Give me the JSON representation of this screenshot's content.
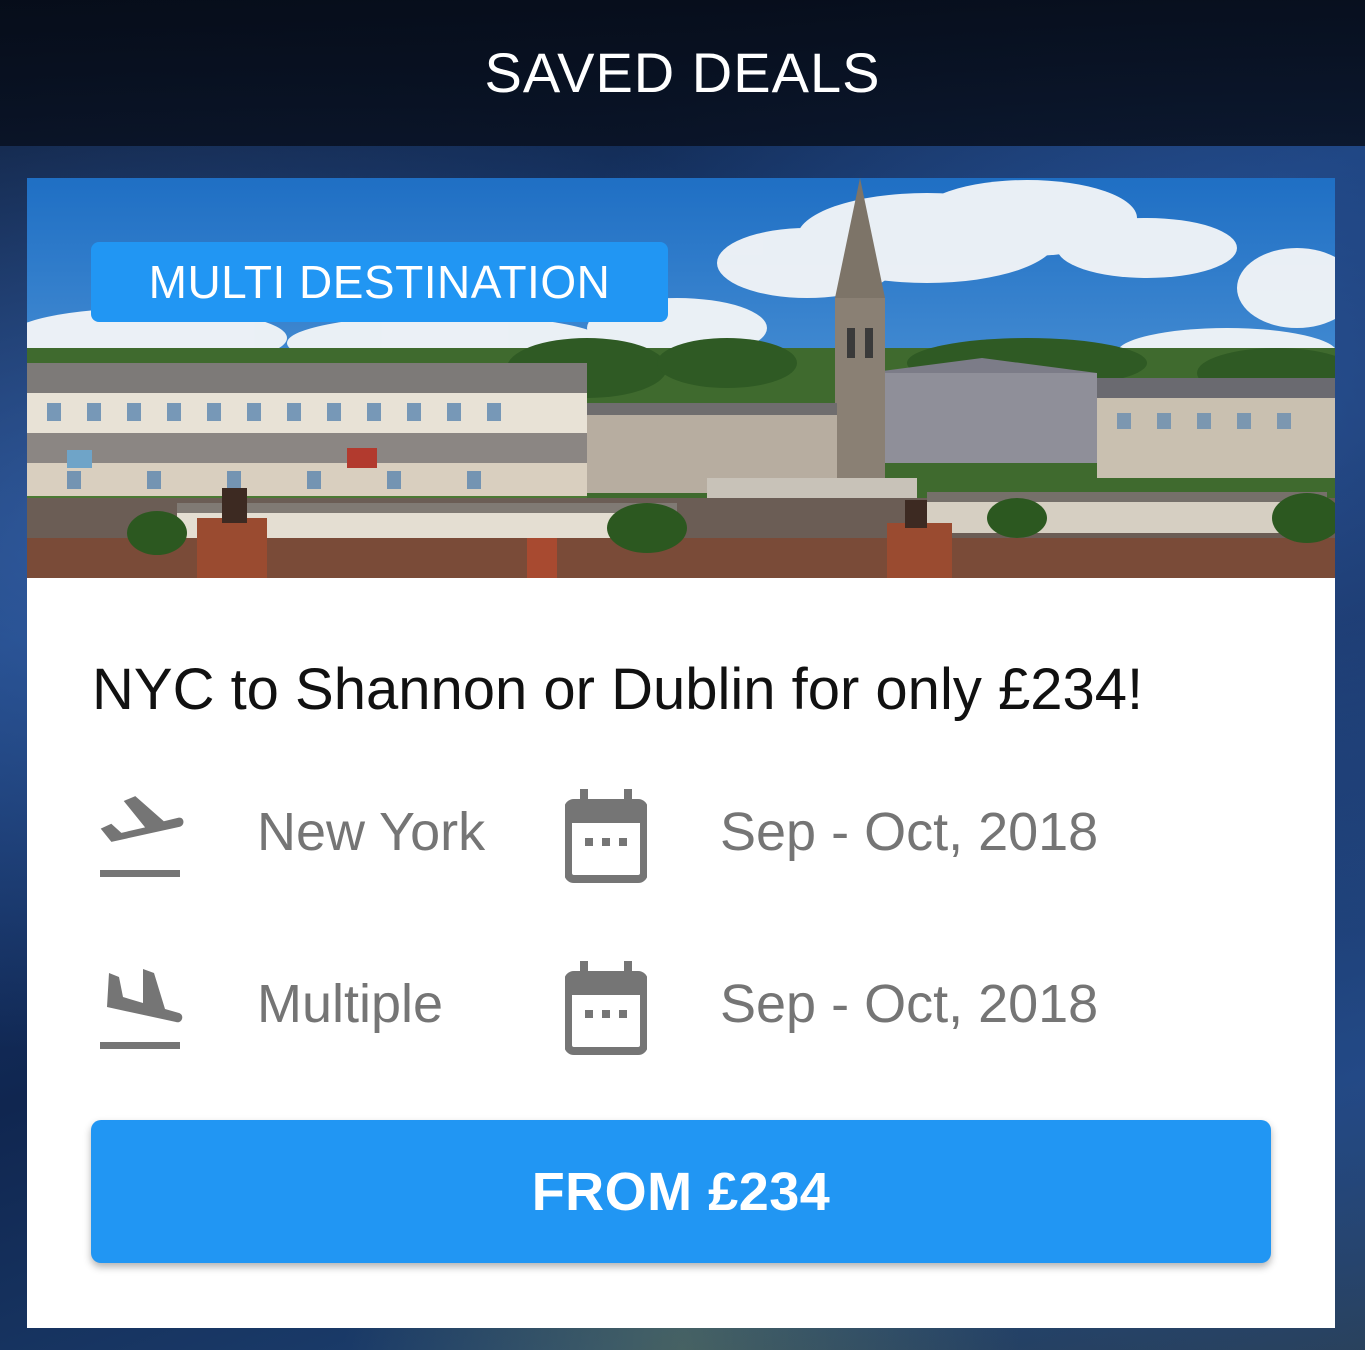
{
  "header": {
    "title": "SAVED DEALS"
  },
  "deal": {
    "badge": "MULTI DESTINATION",
    "title": "NYC to Shannon or Dublin for only £234!",
    "departure": {
      "icon": "flight-takeoff-icon",
      "city": "New York",
      "date_icon": "calendar-icon",
      "dates": "Sep - Oct, 2018"
    },
    "arrival": {
      "icon": "flight-land-icon",
      "city": "Multiple",
      "date_icon": "calendar-icon",
      "dates": "Sep - Oct, 2018"
    },
    "cta_label": "FROM £234"
  },
  "colors": {
    "accent": "#2196f3",
    "icon_gray": "#757575",
    "text_dark": "#111111"
  }
}
